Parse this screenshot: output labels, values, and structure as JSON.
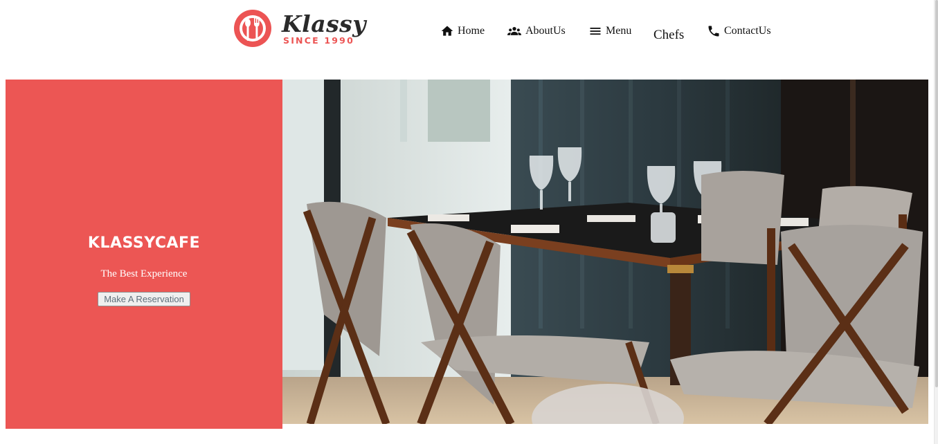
{
  "header": {
    "logo": {
      "word": "Klassy",
      "since": "SINCE 1990"
    },
    "nav": [
      {
        "label": "Home",
        "icon": "home-icon"
      },
      {
        "label": "AboutUs",
        "icon": "people-icon"
      },
      {
        "label": "Menu",
        "icon": "menu-icon"
      },
      {
        "label": "Chefs"
      },
      {
        "label": "ContactUs",
        "icon": "phone-icon"
      }
    ]
  },
  "hero": {
    "title": "KLASSYCAFE",
    "subtitle": "The Best Experience",
    "button": "Make A Reservation",
    "panel_color": "#ec5654",
    "photo": "restaurant-interior-photo"
  },
  "colors": {
    "accent": "#ec5454"
  }
}
